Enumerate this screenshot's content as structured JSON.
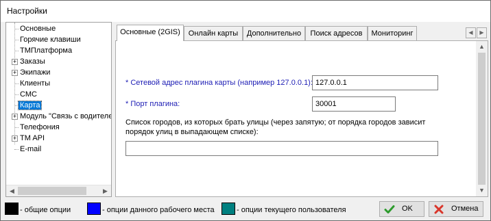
{
  "window": {
    "title": "Настройки"
  },
  "tree": {
    "items": [
      {
        "label": "Основные",
        "expandable": false
      },
      {
        "label": "Горячие клавиши",
        "expandable": false
      },
      {
        "label": "ТМПлатформа",
        "expandable": false
      },
      {
        "label": "Заказы",
        "expandable": true
      },
      {
        "label": "Экипажи",
        "expandable": true
      },
      {
        "label": "Клиенты",
        "expandable": false
      },
      {
        "label": "СМС",
        "expandable": false
      },
      {
        "label": "Карта",
        "expandable": false,
        "selected": true
      },
      {
        "label": "Модуль \"Связь с водителем\"",
        "expandable": true
      },
      {
        "label": "Телефония",
        "expandable": false
      },
      {
        "label": "TM API",
        "expandable": true
      },
      {
        "label": "E-mail",
        "expandable": false
      }
    ],
    "expander_glyph": "+"
  },
  "tabs": [
    {
      "label": "Основные (2GIS)",
      "active": true
    },
    {
      "label": "Онлайн карты"
    },
    {
      "label": "Дополнительно"
    },
    {
      "label": "Поиск адресов"
    },
    {
      "label": "Мониторинг"
    }
  ],
  "form": {
    "plugin_address": {
      "label": "* Сетевой адрес плагина карты (например 127.0.0.1):",
      "value": "127.0.0.1"
    },
    "plugin_port": {
      "label": "* Порт плагина:",
      "value": "30001"
    },
    "cities": {
      "label": "Список городов, из которых брать улицы (через запятую; от порядка городов зависит порядок улиц в выпадающем списке):",
      "value": ""
    }
  },
  "legend": [
    {
      "label": "- общие опции",
      "color": "#000000"
    },
    {
      "label": "- опции данного рабочего места",
      "color": "#0000ff"
    },
    {
      "label": "- опции текущего пользователя",
      "color": "#008080"
    }
  ],
  "buttons": {
    "ok": {
      "label": "OK",
      "icon": "checkmark-icon",
      "color": "#2d9b2d"
    },
    "cancel": {
      "label": "Отмена",
      "icon": "cross-icon",
      "color": "#d9352a"
    }
  }
}
